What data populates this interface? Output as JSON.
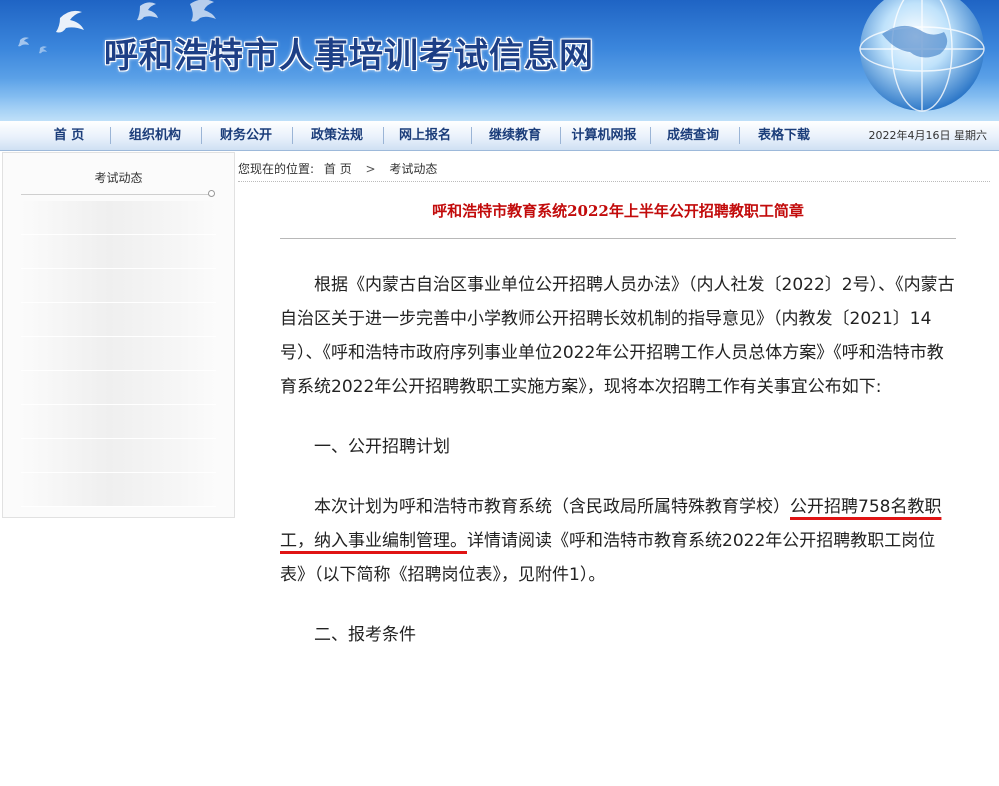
{
  "header": {
    "site_title": "呼和浩特市人事培训考试信息网"
  },
  "nav": {
    "items": [
      "首 页",
      "组织机构",
      "财务公开",
      "政策法规",
      "网上报名",
      "继续教育",
      "计算机网报",
      "成绩查询",
      "表格下载"
    ],
    "date": "2022年4月16日 星期六"
  },
  "sidebar": {
    "title": "考试动态"
  },
  "breadcrumb": {
    "prefix": "您现在的位置:",
    "home": "首 页",
    "arrow": ">",
    "current": "考试动态"
  },
  "article": {
    "title": "呼和浩特市教育系统2022年上半年公开招聘教职工简章",
    "p1": "根据《内蒙古自治区事业单位公开招聘人员办法》（内人社发〔2022〕2号）、《内蒙古自治区关于进一步完善中小学教师公开招聘长效机制的指导意见》（内教发〔2021〕14号）、《呼和浩特市政府序列事业单位2022年公开招聘工作人员总体方案》《呼和浩特市教育系统2022年公开招聘教职工实施方案》，现将本次招聘工作有关事宜公布如下:",
    "h1": "一、公开招聘计划",
    "p3_a": "本次计划为呼和浩特市教育系统（含民政局所属特殊教育学校）",
    "p3_mark": "公开招聘758名教职工，纳入事业编制管理。",
    "p3_b": "详情请阅读《呼和浩特市教育系统2022年公开招聘教职工岗位表》（以下简称《招聘岗位表》，见附件1）。",
    "h2": "二、报考条件"
  },
  "colors": {
    "banner": "#2f7bd6",
    "nav_text": "#1b3d7a",
    "title_red": "#c20b0b",
    "highlight": "#e01414"
  },
  "icons": [
    "doves-graphic",
    "globe-graphic"
  ]
}
